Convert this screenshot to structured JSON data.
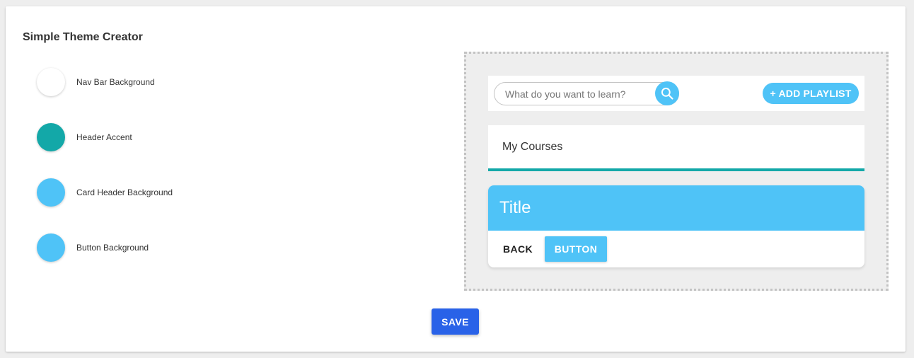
{
  "page": {
    "title": "Simple Theme Creator"
  },
  "theme_options": [
    {
      "label": "Nav Bar Background",
      "color": "#ffffff"
    },
    {
      "label": "Header Accent",
      "color": "#13a8a8"
    },
    {
      "label": "Card Header Background",
      "color": "#4fc3f7"
    },
    {
      "label": "Button Background",
      "color": "#4fc3f7"
    }
  ],
  "preview": {
    "search": {
      "placeholder": "What do you want to learn?",
      "icon": "search-icon"
    },
    "add_playlist_label": "+ ADD PLAYLIST",
    "header_text": "My Courses",
    "card": {
      "title": "Title",
      "back_label": "BACK",
      "button_label": "BUTTON"
    }
  },
  "save_label": "SAVE",
  "colors": {
    "nav_bg": "#ffffff",
    "header_accent": "#13a8a8",
    "card_header_bg": "#4fc3f7",
    "button_bg": "#4fc3f7",
    "save_bg": "#2962e8"
  }
}
